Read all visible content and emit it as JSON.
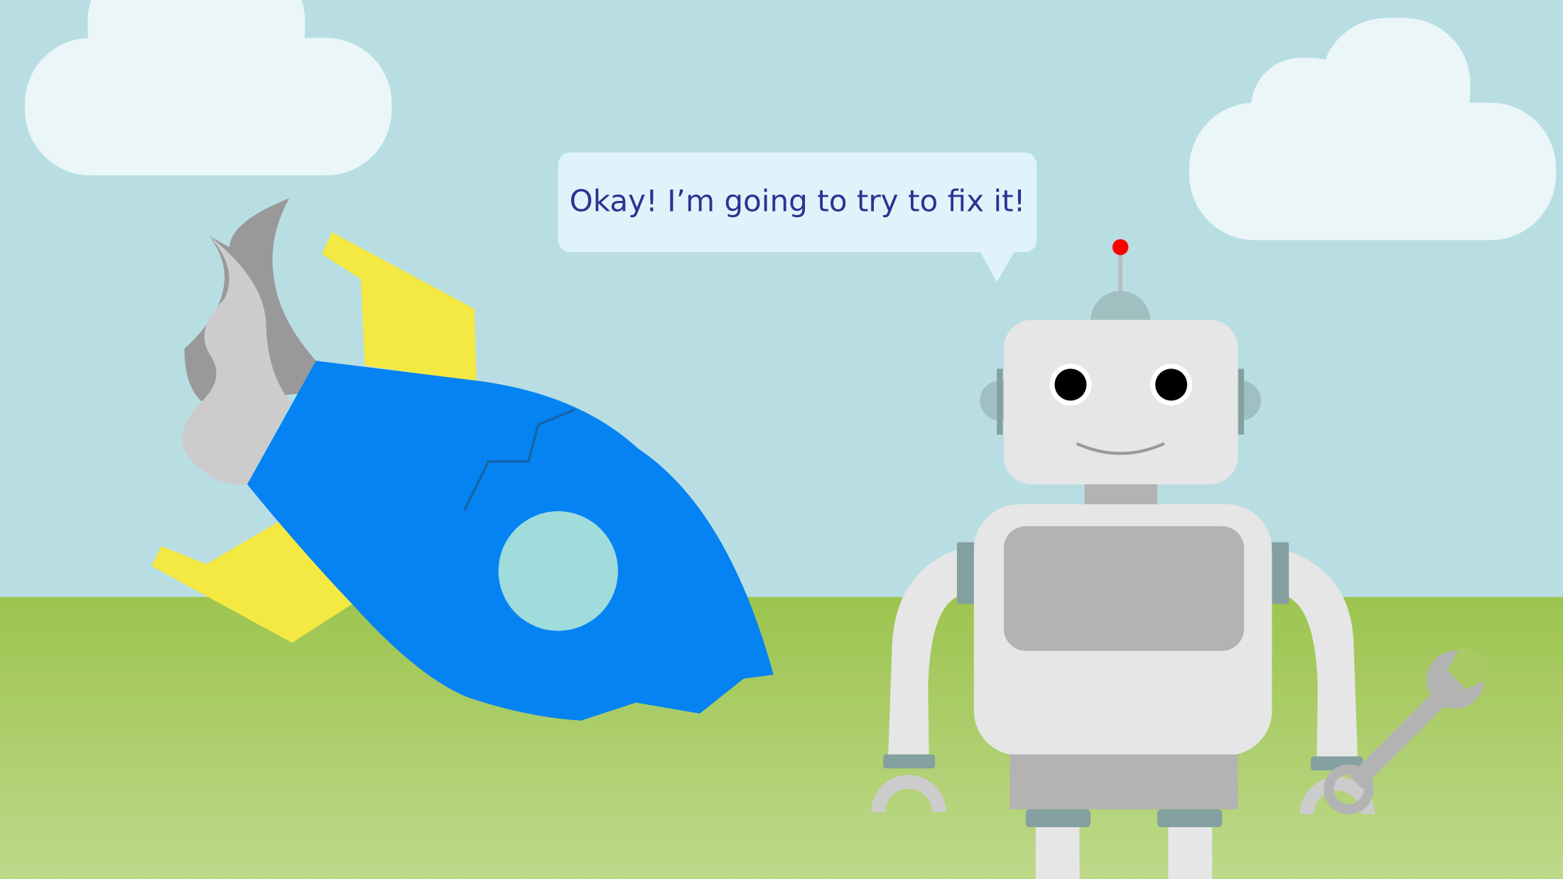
{
  "scene": {
    "speech_bubble": {
      "text": "Okay! I’m going to try to fix it!"
    },
    "colors": {
      "sky": "#b8dee3",
      "ground_top": "#9dc44f",
      "ground_bottom": "#bdd98a",
      "cloud": "#eaf6f8",
      "bubble": "#e0f3fb",
      "bubble_text": "#2e3192",
      "rocket_body": "#0583f2",
      "rocket_fin": "#f4e842",
      "rocket_window": "#a1dcdc",
      "robot_light": "#e6e6e6",
      "robot_mid": "#b3b3b3",
      "robot_accent": "#84a0a0",
      "antenna_light": "#ff0000"
    }
  }
}
